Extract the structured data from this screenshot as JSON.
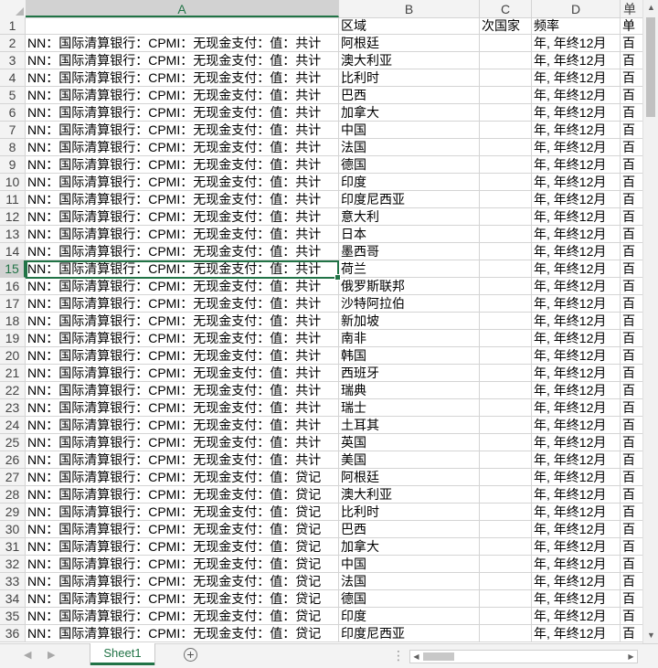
{
  "columns": [
    "A",
    "B",
    "C",
    "D",
    "单"
  ],
  "selected_column": "A",
  "selected_row": "15",
  "header_row": {
    "num": "1",
    "A": "",
    "B": "区域",
    "C": "次国家",
    "D": "频率",
    "E": "单"
  },
  "rows": [
    {
      "num": "2",
      "A": "NN：国际清算银行：CPMI：无现金支付：值：共计",
      "B": "阿根廷",
      "C": "",
      "D": "年, 年终12月",
      "E": "百"
    },
    {
      "num": "3",
      "A": "NN：国际清算银行：CPMI：无现金支付：值：共计",
      "B": "澳大利亚",
      "C": "",
      "D": "年, 年终12月",
      "E": "百"
    },
    {
      "num": "4",
      "A": "NN：国际清算银行：CPMI：无现金支付：值：共计",
      "B": "比利时",
      "C": "",
      "D": "年, 年终12月",
      "E": "百"
    },
    {
      "num": "5",
      "A": "NN：国际清算银行：CPMI：无现金支付：值：共计",
      "B": "巴西",
      "C": "",
      "D": "年, 年终12月",
      "E": "百"
    },
    {
      "num": "6",
      "A": "NN：国际清算银行：CPMI：无现金支付：值：共计",
      "B": "加拿大",
      "C": "",
      "D": "年, 年终12月",
      "E": "百"
    },
    {
      "num": "7",
      "A": "NN：国际清算银行：CPMI：无现金支付：值：共计",
      "B": "中国",
      "C": "",
      "D": "年, 年终12月",
      "E": "百"
    },
    {
      "num": "8",
      "A": "NN：国际清算银行：CPMI：无现金支付：值：共计",
      "B": "法国",
      "C": "",
      "D": "年, 年终12月",
      "E": "百"
    },
    {
      "num": "9",
      "A": "NN：国际清算银行：CPMI：无现金支付：值：共计",
      "B": "德国",
      "C": "",
      "D": "年, 年终12月",
      "E": "百"
    },
    {
      "num": "10",
      "A": "NN：国际清算银行：CPMI：无现金支付：值：共计",
      "B": "印度",
      "C": "",
      "D": "年, 年终12月",
      "E": "百"
    },
    {
      "num": "11",
      "A": "NN：国际清算银行：CPMI：无现金支付：值：共计",
      "B": "印度尼西亚",
      "C": "",
      "D": "年, 年终12月",
      "E": "百"
    },
    {
      "num": "12",
      "A": "NN：国际清算银行：CPMI：无现金支付：值：共计",
      "B": "意大利",
      "C": "",
      "D": "年, 年终12月",
      "E": "百"
    },
    {
      "num": "13",
      "A": "NN：国际清算银行：CPMI：无现金支付：值：共计",
      "B": "日本",
      "C": "",
      "D": "年, 年终12月",
      "E": "百"
    },
    {
      "num": "14",
      "A": "NN：国际清算银行：CPMI：无现金支付：值：共计",
      "B": "墨西哥",
      "C": "",
      "D": "年, 年终12月",
      "E": "百"
    },
    {
      "num": "15",
      "A": "NN：国际清算银行：CPMI：无现金支付：值：共计",
      "B": "荷兰",
      "C": "",
      "D": "年, 年终12月",
      "E": "百"
    },
    {
      "num": "16",
      "A": "NN：国际清算银行：CPMI：无现金支付：值：共计",
      "B": "俄罗斯联邦",
      "C": "",
      "D": "年, 年终12月",
      "E": "百"
    },
    {
      "num": "17",
      "A": "NN：国际清算银行：CPMI：无现金支付：值：共计",
      "B": "沙特阿拉伯",
      "C": "",
      "D": "年, 年终12月",
      "E": "百"
    },
    {
      "num": "18",
      "A": "NN：国际清算银行：CPMI：无现金支付：值：共计",
      "B": "新加坡",
      "C": "",
      "D": "年, 年终12月",
      "E": "百"
    },
    {
      "num": "19",
      "A": "NN：国际清算银行：CPMI：无现金支付：值：共计",
      "B": "南非",
      "C": "",
      "D": "年, 年终12月",
      "E": "百"
    },
    {
      "num": "20",
      "A": "NN：国际清算银行：CPMI：无现金支付：值：共计",
      "B": "韩国",
      "C": "",
      "D": "年, 年终12月",
      "E": "百"
    },
    {
      "num": "21",
      "A": "NN：国际清算银行：CPMI：无现金支付：值：共计",
      "B": "西班牙",
      "C": "",
      "D": "年, 年终12月",
      "E": "百"
    },
    {
      "num": "22",
      "A": "NN：国际清算银行：CPMI：无现金支付：值：共计",
      "B": "瑞典",
      "C": "",
      "D": "年, 年终12月",
      "E": "百"
    },
    {
      "num": "23",
      "A": "NN：国际清算银行：CPMI：无现金支付：值：共计",
      "B": "瑞士",
      "C": "",
      "D": "年, 年终12月",
      "E": "百"
    },
    {
      "num": "24",
      "A": "NN：国际清算银行：CPMI：无现金支付：值：共计",
      "B": "土耳其",
      "C": "",
      "D": "年, 年终12月",
      "E": "百"
    },
    {
      "num": "25",
      "A": "NN：国际清算银行：CPMI：无现金支付：值：共计",
      "B": "英国",
      "C": "",
      "D": "年, 年终12月",
      "E": "百"
    },
    {
      "num": "26",
      "A": "NN：国际清算银行：CPMI：无现金支付：值：共计",
      "B": "美国",
      "C": "",
      "D": "年, 年终12月",
      "E": "百"
    },
    {
      "num": "27",
      "A": "NN：国际清算银行：CPMI：无现金支付：值：贷记",
      "B": "阿根廷",
      "C": "",
      "D": "年, 年终12月",
      "E": "百"
    },
    {
      "num": "28",
      "A": "NN：国际清算银行：CPMI：无现金支付：值：贷记",
      "B": "澳大利亚",
      "C": "",
      "D": "年, 年终12月",
      "E": "百"
    },
    {
      "num": "29",
      "A": "NN：国际清算银行：CPMI：无现金支付：值：贷记",
      "B": "比利时",
      "C": "",
      "D": "年, 年终12月",
      "E": "百"
    },
    {
      "num": "30",
      "A": "NN：国际清算银行：CPMI：无现金支付：值：贷记",
      "B": "巴西",
      "C": "",
      "D": "年, 年终12月",
      "E": "百"
    },
    {
      "num": "31",
      "A": "NN：国际清算银行：CPMI：无现金支付：值：贷记",
      "B": "加拿大",
      "C": "",
      "D": "年, 年终12月",
      "E": "百"
    },
    {
      "num": "32",
      "A": "NN：国际清算银行：CPMI：无现金支付：值：贷记",
      "B": "中国",
      "C": "",
      "D": "年, 年终12月",
      "E": "百"
    },
    {
      "num": "33",
      "A": "NN：国际清算银行：CPMI：无现金支付：值：贷记",
      "B": "法国",
      "C": "",
      "D": "年, 年终12月",
      "E": "百"
    },
    {
      "num": "34",
      "A": "NN：国际清算银行：CPMI：无现金支付：值：贷记",
      "B": "德国",
      "C": "",
      "D": "年, 年终12月",
      "E": "百"
    },
    {
      "num": "35",
      "A": "NN：国际清算银行：CPMI：无现金支付：值：贷记",
      "B": "印度",
      "C": "",
      "D": "年, 年终12月",
      "E": "百"
    },
    {
      "num": "36",
      "A": "NN：国际清算银行：CPMI：无现金支付：值：贷记",
      "B": "印度尼西亚",
      "C": "",
      "D": "年, 年终12月",
      "E": "百"
    }
  ],
  "sheet_tabs": [
    {
      "label": "Sheet1",
      "active": true
    }
  ],
  "icons": {
    "nav_prev": "chevron-left-icon",
    "nav_next": "chevron-right-icon",
    "add_sheet": "plus-circle-icon",
    "more": "vertical-dots-icon",
    "scroll_up": "triangle-up-icon",
    "scroll_down": "triangle-down-icon",
    "scroll_left": "triangle-left-icon",
    "scroll_right": "triangle-right-icon"
  },
  "colors": {
    "accent": "#217346",
    "gridline": "#d4d4d4",
    "header_bg": "#f3f3f3"
  }
}
